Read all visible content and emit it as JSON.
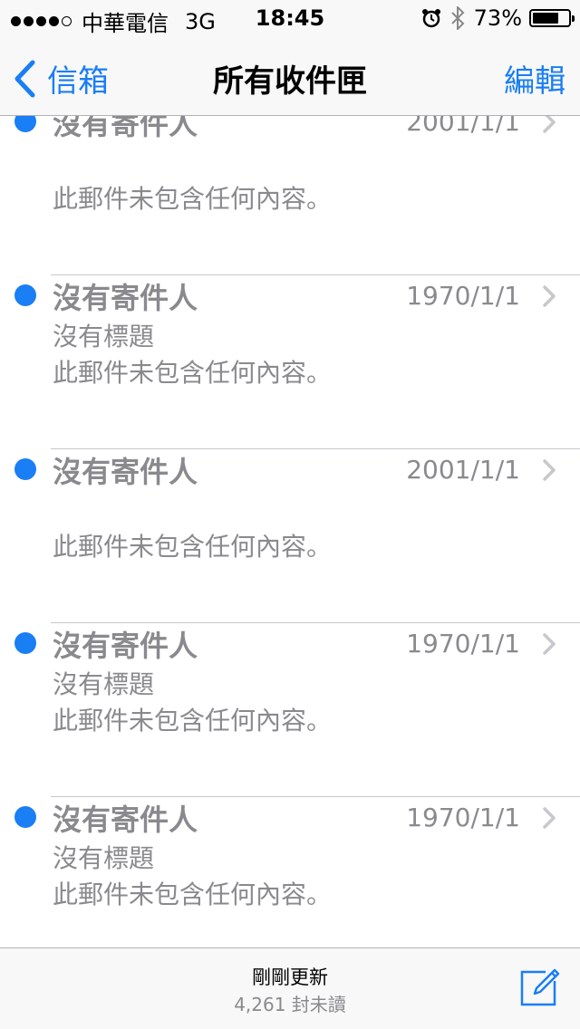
{
  "status_bar": {
    "carrier": "中華電信",
    "network": "3G",
    "time": "18:45",
    "battery_percent": "73%",
    "battery_level": 0.73
  },
  "nav": {
    "back_label": "信箱",
    "title": "所有收件匣",
    "edit_label": "編輯"
  },
  "mails": [
    {
      "sender": "沒有寄件人",
      "date": "2001/1/1",
      "subject": "",
      "preview": "此郵件未包含任何內容。"
    },
    {
      "sender": "沒有寄件人",
      "date": "1970/1/1",
      "subject": "沒有標題",
      "preview": "此郵件未包含任何內容。"
    },
    {
      "sender": "沒有寄件人",
      "date": "2001/1/1",
      "subject": "",
      "preview": "此郵件未包含任何內容。"
    },
    {
      "sender": "沒有寄件人",
      "date": "1970/1/1",
      "subject": "沒有標題",
      "preview": "此郵件未包含任何內容。"
    },
    {
      "sender": "沒有寄件人",
      "date": "1970/1/1",
      "subject": "沒有標題",
      "preview": "此郵件未包含任何內容。"
    }
  ],
  "toolbar": {
    "updated": "剛剛更新",
    "unread": "4,261 封未讀"
  },
  "colors": {
    "accent": "#1a7ef5",
    "secondary_text": "#8a8a8e"
  },
  "icons": {
    "back": "chevron-left-icon",
    "alarm": "alarm-clock-icon",
    "bluetooth": "bluetooth-icon",
    "battery": "battery-icon",
    "disclosure": "chevron-right-icon",
    "compose": "compose-icon"
  }
}
